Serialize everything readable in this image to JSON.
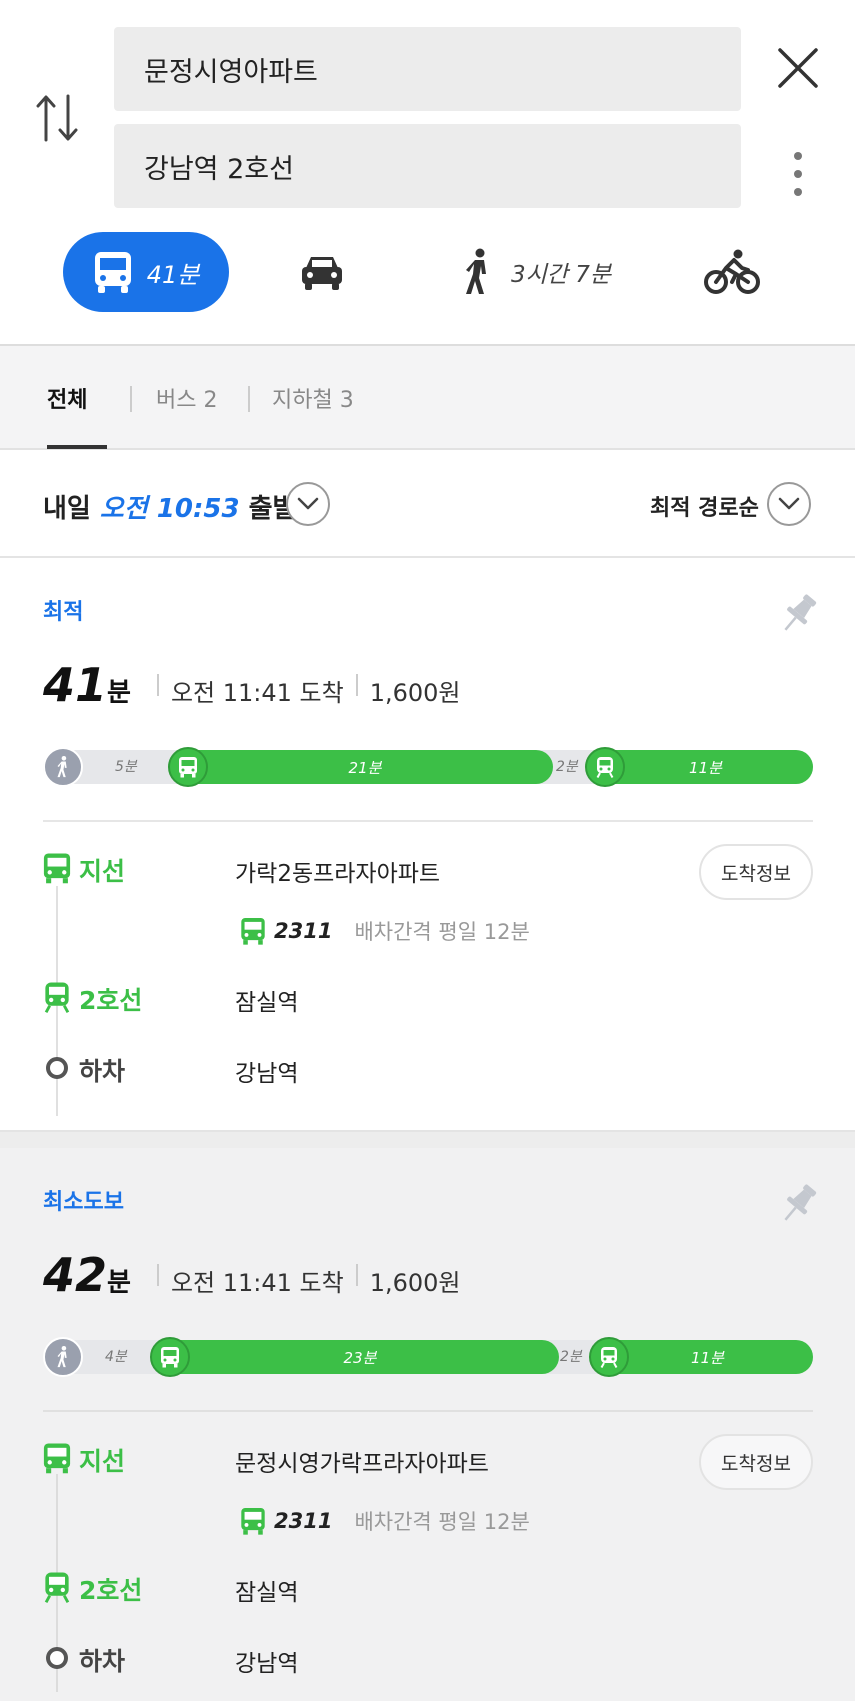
{
  "search": {
    "origin": "문정시영아파트",
    "destination": "강남역 2호선"
  },
  "modes": {
    "transit_time": "41분",
    "walk_time": "3시간 7분"
  },
  "tabs": {
    "all": "전체",
    "bus": "버스 2",
    "subway": "지하철 3"
  },
  "depart": {
    "prefix": "내일",
    "time": "오전 10:53",
    "suffix": "출발",
    "sort": "최적 경로순"
  },
  "colors": {
    "accent": "#1a73e8",
    "bus_green": "#3cbf47",
    "walk_grey": "#9aa0ae"
  },
  "routes": [
    {
      "label": "최적",
      "minutes": "41",
      "unit": "분",
      "arrival": "오전 11:41 도착",
      "fare": "1,600원",
      "timeline": {
        "walk": "5분",
        "bus": "21분",
        "gap": "2분",
        "train": "11분"
      },
      "steps": [
        {
          "type": "지선",
          "stop": "가락2동프라자아파트",
          "button": "도착정보",
          "bus_no": "2311",
          "interval": "배차간격 평일 12분"
        },
        {
          "type": "2호선",
          "stop": "잠실역"
        },
        {
          "type": "하차",
          "stop": "강남역"
        }
      ]
    },
    {
      "label": "최소도보",
      "minutes": "42",
      "unit": "분",
      "arrival": "오전 11:41 도착",
      "fare": "1,600원",
      "timeline": {
        "walk": "4분",
        "bus": "23분",
        "gap": "2분",
        "train": "11분"
      },
      "steps": [
        {
          "type": "지선",
          "stop": "문정시영가락프라자아파트",
          "button": "도착정보",
          "bus_no": "2311",
          "interval": "배차간격 평일 12분"
        },
        {
          "type": "2호선",
          "stop": "잠실역"
        },
        {
          "type": "하차",
          "stop": "강남역"
        }
      ]
    }
  ]
}
